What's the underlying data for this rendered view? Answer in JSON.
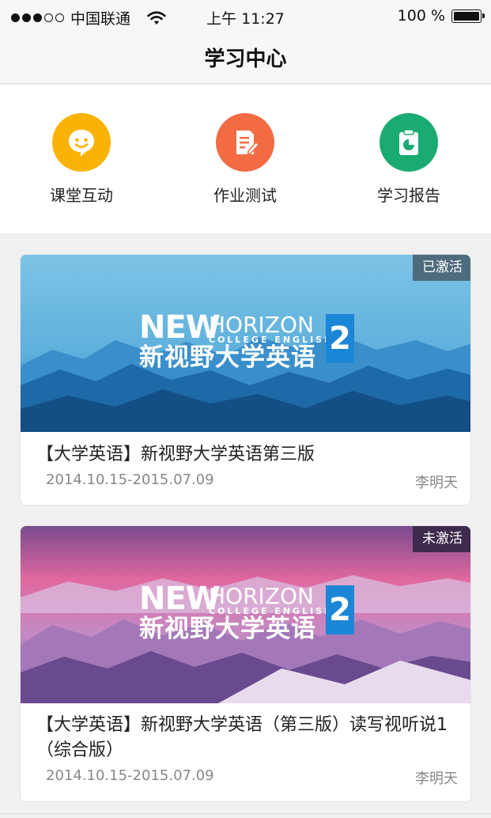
{
  "status_bar": {
    "carrier": "中国联通",
    "time": "上午 11:27",
    "battery": "100 %"
  },
  "nav": {
    "title": "学习中心"
  },
  "actions": [
    {
      "label": "课堂互动",
      "icon": "smile-chat-icon",
      "color": "#f9b304"
    },
    {
      "label": "作业测试",
      "icon": "document-edit-icon",
      "color": "#f26b43"
    },
    {
      "label": "学习报告",
      "icon": "clipboard-chart-icon",
      "color": "#1aab73"
    }
  ],
  "courses": [
    {
      "badge": "已激活",
      "badge_color": "#4e6b7e",
      "cover_theme": "blue-mountains",
      "logo": {
        "word_new": "NEW",
        "word_horizon": "HORIZON",
        "subtitle": "COLLEGE ENGLISH",
        "cn_title": "新视野大学英语",
        "volume": "2"
      },
      "title": "【大学英语】新视野大学英语第三版",
      "date": "2014.10.15-2015.07.09",
      "teacher": "李明天"
    },
    {
      "badge": "未激活",
      "badge_color": "#3d2a4d",
      "cover_theme": "pink-mountains",
      "logo": {
        "word_new": "NEW",
        "word_horizon": "HORIZON",
        "subtitle": "COLLEGE ENGLISH",
        "cn_title": "新视野大学英语",
        "volume": "2"
      },
      "title": "【大学英语】新视野大学英语（第三版）读写视听说1（综合版）",
      "date": "2014.10.15-2015.07.09",
      "teacher": "李明天"
    }
  ]
}
